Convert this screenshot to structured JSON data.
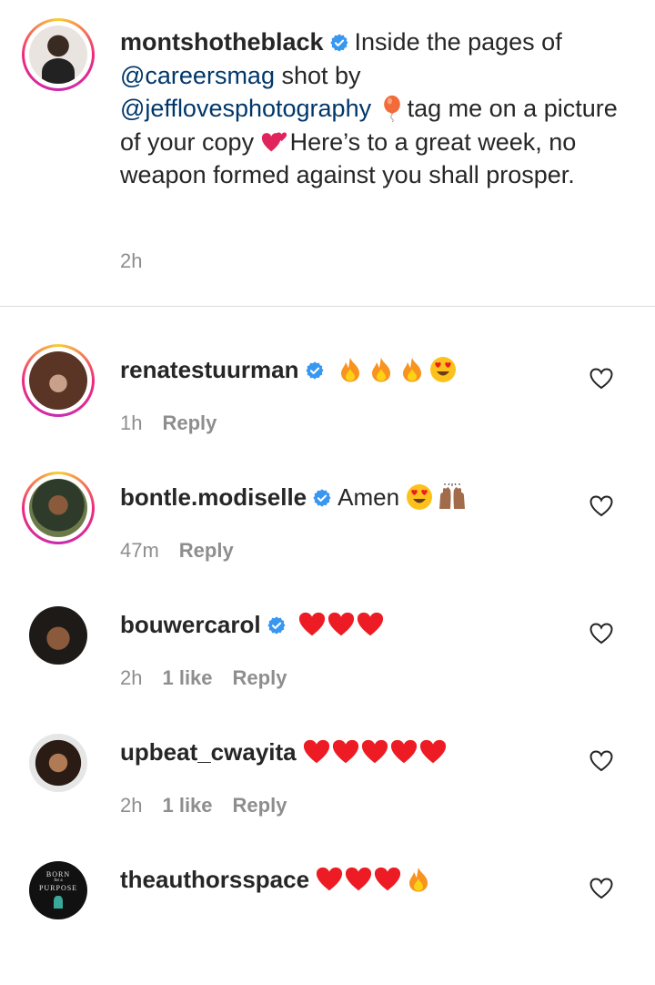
{
  "caption": {
    "username": "montshotheblack",
    "text_1": "Inside the pages of",
    "mention_1": "@careersmag",
    "text_2": "shot by",
    "mention_2": "@jefflovesphotography",
    "text_3": "tag me on a picture of your copy",
    "text_4": "Here’s to a great week, no weapon formed against you shall prosper.",
    "time": "2h",
    "emoji": [
      "balloon",
      "two-hearts"
    ]
  },
  "comments": [
    {
      "username": "renatestuurman",
      "verified": true,
      "text": "",
      "emoji": [
        "fire",
        "fire",
        "fire",
        "heart-eyes"
      ],
      "time": "1h",
      "likes": "",
      "reply": "Reply"
    },
    {
      "username": "bontle.modiselle",
      "verified": true,
      "text": "Amen",
      "emoji": [
        "heart-eyes",
        "raising-hands"
      ],
      "time": "47m",
      "likes": "",
      "reply": "Reply"
    },
    {
      "username": "bouwercarol",
      "verified": true,
      "text": "",
      "emoji": [
        "red-heart",
        "red-heart",
        "red-heart"
      ],
      "time": "2h",
      "likes": "1 like",
      "reply": "Reply"
    },
    {
      "username": "upbeat_cwayita",
      "verified": false,
      "text": "",
      "emoji": [
        "red-heart",
        "red-heart",
        "red-heart",
        "red-heart",
        "red-heart"
      ],
      "time": "2h",
      "likes": "1 like",
      "reply": "Reply"
    },
    {
      "username": "theauthorsspace",
      "verified": false,
      "text": "",
      "emoji": [
        "red-heart",
        "red-heart",
        "red-heart",
        "fire"
      ],
      "time": "",
      "likes": "",
      "reply": ""
    }
  ],
  "avatar_5_text": {
    "line1": "BORN",
    "line2": "for a",
    "line3": "PURPOSE"
  },
  "colors": {
    "mention": "#00376b",
    "verified": "#3897f0",
    "meta": "#8e8e8e",
    "heart": "#ed1c24"
  }
}
